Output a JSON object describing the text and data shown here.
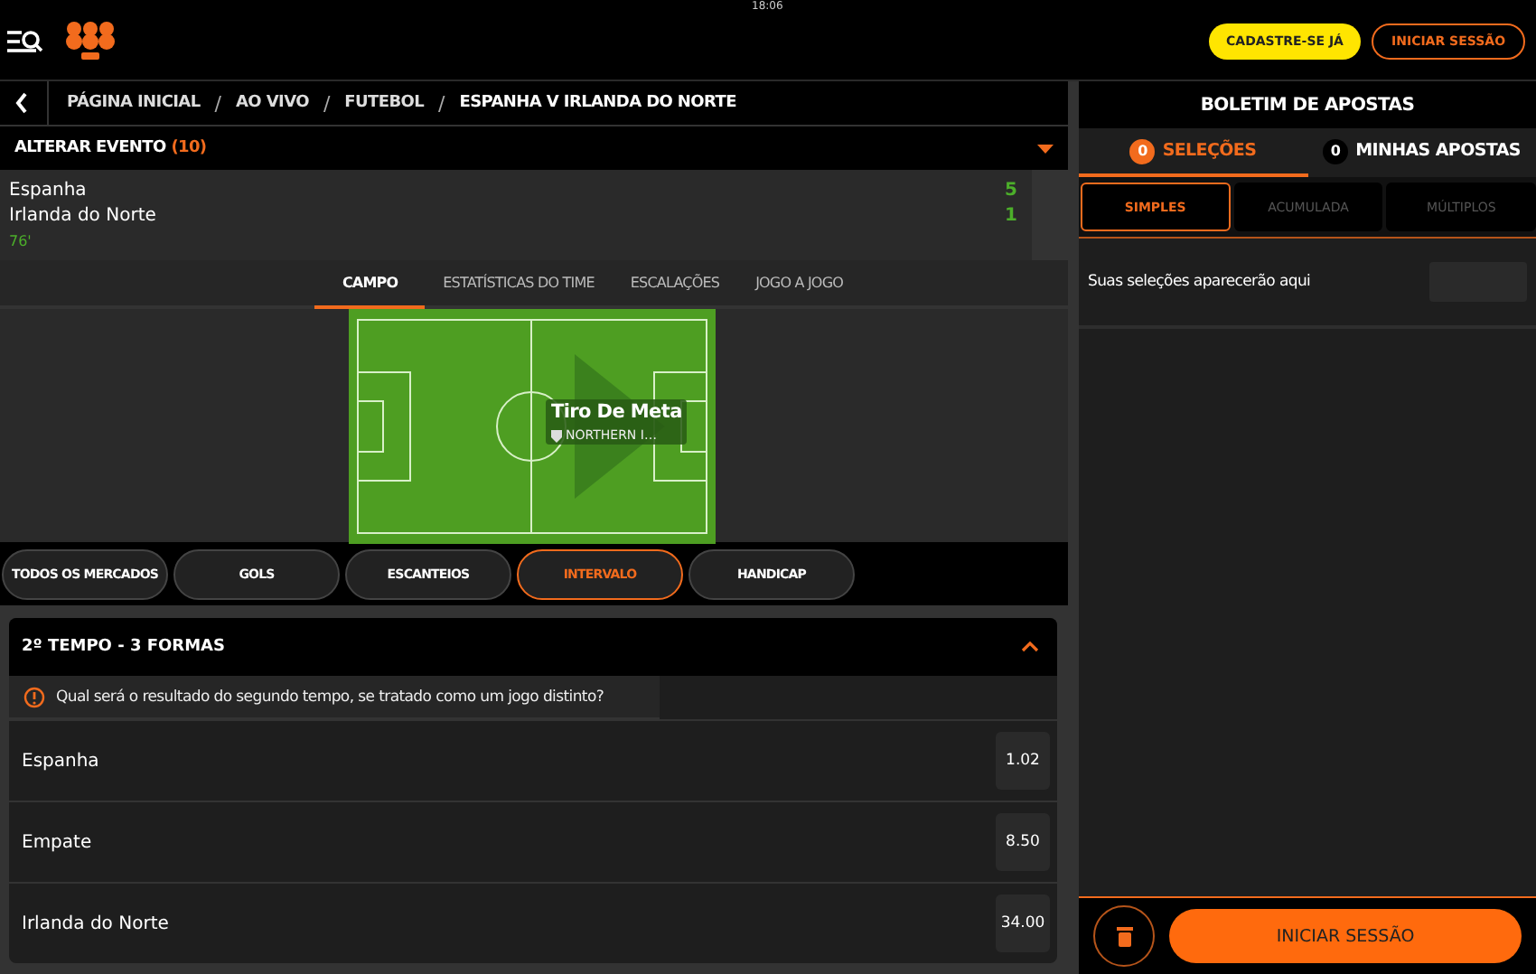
{
  "status_time": "18:06",
  "header": {
    "buttons": [
      {
        "label": "CADASTRE-SE JÁ",
        "kind": "primary"
      },
      {
        "label": "INICIAR SESSÃO",
        "kind": "outline"
      }
    ]
  },
  "breadcrumb": {
    "separator": "/",
    "items": [
      "PÁGINA INICIAL",
      "AO VIVO",
      "FUTEBOL",
      "ESPANHA V IRLANDA DO NORTE"
    ]
  },
  "change_event": {
    "label": "ALTERAR EVENTO",
    "count": "(10)"
  },
  "scoreboard": {
    "teams": [
      {
        "name": "Espanha",
        "score": "5"
      },
      {
        "name": "Irlanda do Norte",
        "score": "1"
      }
    ],
    "minute": "76'"
  },
  "tabs": [
    {
      "label": "CAMPO",
      "selected": true
    },
    {
      "label": "ESTATÍSTICAS DO TIME",
      "selected": false
    },
    {
      "label": "ESCALAÇÕES",
      "selected": false
    },
    {
      "label": "JOGO A JOGO",
      "selected": false
    }
  ],
  "pitch": {
    "event": "Tiro De Meta",
    "team": "NORTHERN I…"
  },
  "filters": [
    {
      "label": "TODOS OS MERCADOS",
      "selected": false
    },
    {
      "label": "GOLS",
      "selected": false
    },
    {
      "label": "ESCANTEIOS",
      "selected": false
    },
    {
      "label": "INTERVALO",
      "selected": true
    },
    {
      "label": "HANDICAP",
      "selected": false
    }
  ],
  "market": {
    "title": "2º TEMPO - 3 FORMAS",
    "expanded": true,
    "question": "Qual será o resultado do segundo tempo, se tratado como um jogo distinto?",
    "outcomes": [
      {
        "name": "Espanha",
        "odds": "1.02"
      },
      {
        "name": "Empate",
        "odds": "8.50"
      },
      {
        "name": "Irlanda do Norte",
        "odds": "34.00"
      }
    ]
  },
  "betslip": {
    "title": "BOLETIM DE APOSTAS",
    "tabs": [
      {
        "count": "0",
        "label": "SELEÇÕES",
        "selected": true
      },
      {
        "count": "0",
        "label": "MINHAS APOSTAS",
        "selected": false
      }
    ],
    "bet_types": [
      {
        "label": "SIMPLES",
        "selected": true
      },
      {
        "label": "ACUMULADA",
        "selected": false
      },
      {
        "label": "MÚLTIPLOS",
        "selected": false
      }
    ],
    "empty_message": "Suas seleções aparecerão aqui",
    "login_button": "INICIAR SESSÃO"
  }
}
